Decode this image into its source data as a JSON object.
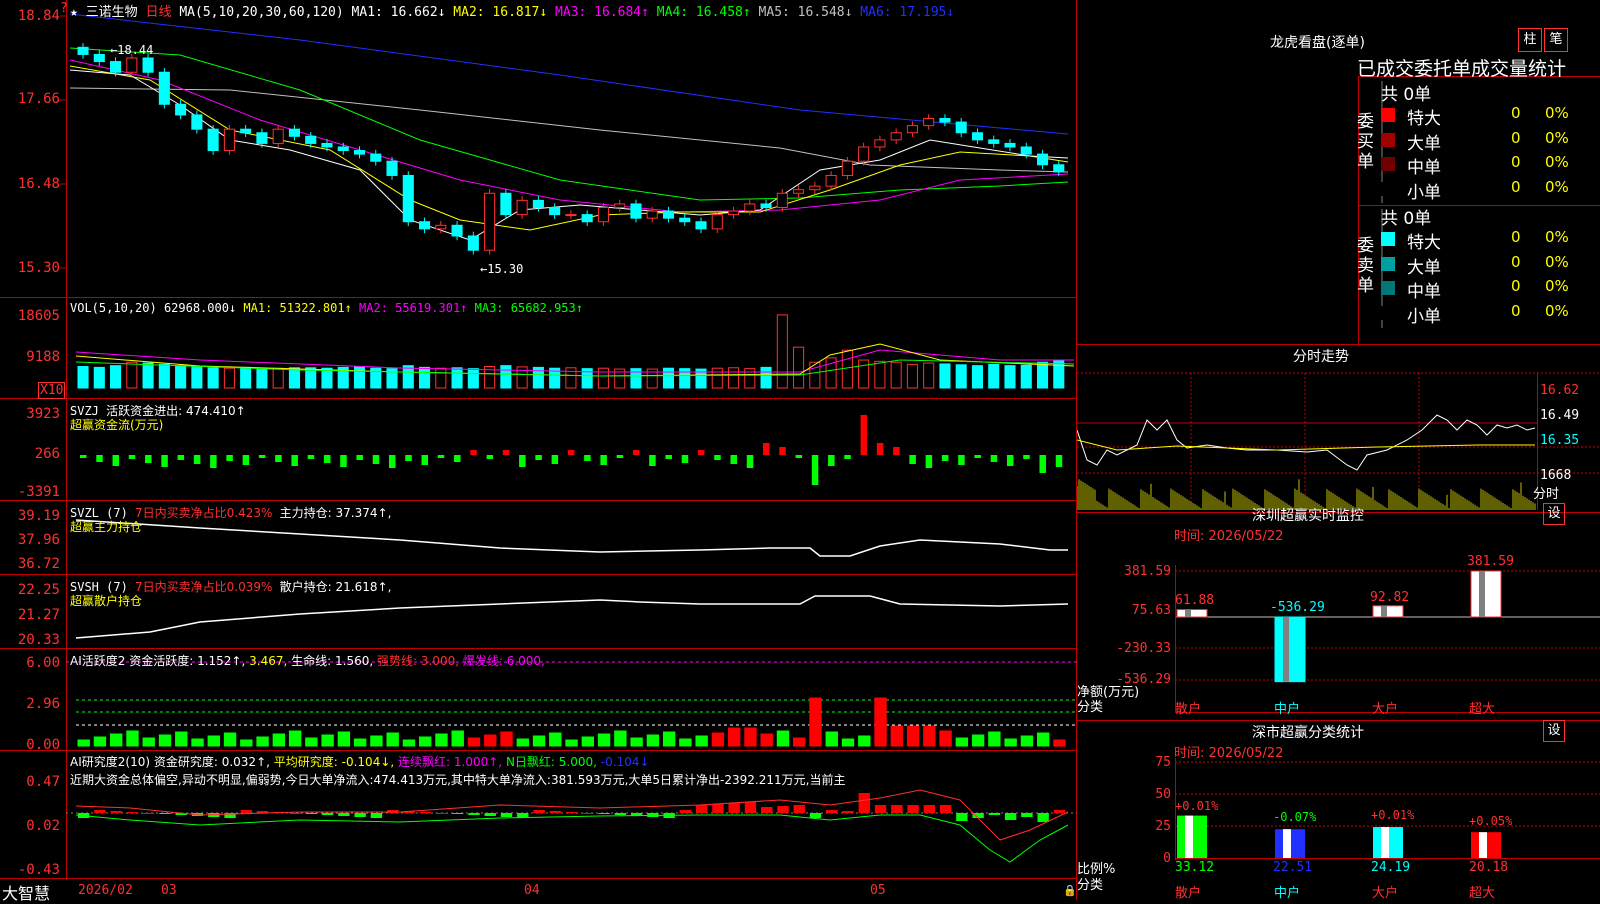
{
  "app": {
    "title": "大智慧"
  },
  "main": {
    "star": "★",
    "stock": "三诺生物",
    "period": "日线",
    "ma_label": "MA(5,10,20,30,60,120)",
    "ma": [
      {
        "text": "MA1: 16.662↓",
        "color": "#ffffff"
      },
      {
        "text": "MA2: 16.817↓",
        "color": "#ffff00"
      },
      {
        "text": "MA3: 16.684↑",
        "color": "#ff00ff"
      },
      {
        "text": "MA4: 16.458↑",
        "color": "#00ff00"
      },
      {
        "text": "MA5: 16.548↓",
        "color": "#c0c0c0"
      },
      {
        "text": "MA6: 17.195↓",
        "color": "#2030ff"
      }
    ],
    "price_axis": [
      "18.84",
      "17.66",
      "16.48",
      "15.30"
    ],
    "high_marker": "←18.44",
    "low_marker": "←15.30"
  },
  "vol": {
    "label": "VOL(5,10,20)",
    "value": "62968.000↓",
    "ma": [
      {
        "text": "MA1: 51322.801↑",
        "color": "#ffff00"
      },
      {
        "text": "MA2: 55619.301↑",
        "color": "#ff00ff"
      },
      {
        "text": "MA3: 65682.953↑",
        "color": "#00ff00"
      }
    ],
    "axis": [
      "18605",
      "9188"
    ],
    "unit": "X10"
  },
  "svzj": {
    "label": "SVZJ",
    "line1": "活跃资金进出: 474.410↑",
    "line2": "超赢资金流(万元)",
    "axis": [
      "3923",
      "266",
      "-3391"
    ]
  },
  "svzl": {
    "label": "SVZL (7)",
    "pct": "7日内买卖净占比0.423%",
    "hold": "主力持仓: 37.374↑,",
    "line2": "超赢主力持仓",
    "axis": [
      "39.19",
      "37.96",
      "36.72"
    ]
  },
  "svsh": {
    "label": "SVSH (7)",
    "pct": "7日内买卖净占比0.039%",
    "hold": "散户持仓: 21.618↑,",
    "line2": "超赢散户持仓",
    "axis": [
      "22.25",
      "21.27",
      "20.33"
    ]
  },
  "ai2": {
    "label": "AI活跃度2",
    "a": "资金活跃度: 1.152↑,",
    "b": "3.467,",
    "c": "生命线: 1.560,",
    "d": "强势线: 3.000,",
    "e": "爆发线: 6.000,",
    "axis": [
      "6.00",
      "2.96",
      "0.00"
    ]
  },
  "ai_research": {
    "label": "AI研究度2(10)",
    "a": "资金研究度: 0.032↑,",
    "b": "平均研究度: -0.104↓,",
    "c": "连续飘红: 1.000↑,",
    "d": "N日飘红: 5.000,",
    "e": "-0.104↓",
    "summary": "近期大资金总体偏空,异动不明显,偏弱势,今日大单净流入:474.413万元,其中特大单净流入:381.593万元,大单5日累计净出-2392.211万元,当前主",
    "axis": [
      "0.47",
      "0.02",
      "-0.43"
    ]
  },
  "date_axis": [
    "2026/02",
    "03",
    "04",
    "05"
  ],
  "lhb": {
    "title": "龙虎看盘(逐单)",
    "btn_bar": "柱",
    "btn_pen": "笔",
    "header": "已成交委托单成交量统计",
    "buy_label": "委买单",
    "sell_label": "委卖单",
    "buy_total": "共 0单",
    "sell_total": "共 0单",
    "buy_rows": [
      {
        "name": "特大",
        "color": "#ff0000",
        "qty": "0",
        "pct": "0%"
      },
      {
        "name": "大单",
        "color": "#a00000",
        "qty": "0",
        "pct": "0%"
      },
      {
        "name": "中单",
        "color": "#700000",
        "qty": "0",
        "pct": "0%"
      },
      {
        "name": "小单",
        "color": "#000000",
        "qty": "0",
        "pct": "0%"
      }
    ],
    "sell_rows": [
      {
        "name": "特大",
        "color": "#00ffff",
        "qty": "0",
        "pct": "0%"
      },
      {
        "name": "大单",
        "color": "#00a0a0",
        "qty": "0",
        "pct": "0%"
      },
      {
        "name": "中单",
        "color": "#007878",
        "qty": "0",
        "pct": "0%"
      },
      {
        "name": "小单",
        "color": "#000000",
        "qty": "0",
        "pct": "0%"
      }
    ]
  },
  "fenshi": {
    "title": "分时走势",
    "axis": [
      "16.62",
      "16.49",
      "16.35"
    ],
    "vol_axis": "1668",
    "label": "分时"
  },
  "monitor": {
    "title": "深圳超赢实时监控",
    "set_btn": "设",
    "time": "时间: 2026/05/22",
    "axis": [
      "381.59",
      "75.63",
      "-230.33",
      "-536.29"
    ],
    "y_label": "净额(万元)",
    "x_label": "分类",
    "values": [
      "61.88",
      "-536.29",
      "92.82",
      "381.59"
    ],
    "categories": [
      "散户",
      "中户",
      "大户",
      "超大"
    ]
  },
  "classify": {
    "title": "深市超赢分类统计",
    "set_btn": "设",
    "time": "时间: 2026/05/22",
    "axis": [
      "75",
      "50",
      "25",
      "0"
    ],
    "y_label": "比例%",
    "x_label": "分类",
    "changes": [
      "+0.01%",
      "-0.07%",
      "+0.01%",
      "+0.05%"
    ],
    "values": [
      "33.12",
      "22.51",
      "24.19",
      "20.18"
    ],
    "categories": [
      "散户",
      "中户",
      "大户",
      "超大"
    ]
  },
  "chart_data": [
    {
      "type": "candlestick",
      "title": "三诺生物 日线",
      "ylim": [
        15.3,
        18.84
      ],
      "ticks": [
        "18.84",
        "17.66",
        "16.48",
        "15.30"
      ],
      "x_labels": [
        "2026/02",
        "03",
        "04",
        "05"
      ],
      "close": [
        18.3,
        18.2,
        18.05,
        18.25,
        18.05,
        17.6,
        17.45,
        17.25,
        16.95,
        17.25,
        17.2,
        17.05,
        17.25,
        17.15,
        17.05,
        17.0,
        16.95,
        16.9,
        16.8,
        16.6,
        15.95,
        15.85,
        15.9,
        15.75,
        15.55,
        16.35,
        16.05,
        16.25,
        16.15,
        16.05,
        16.05,
        15.95,
        16.15,
        16.2,
        16.0,
        16.1,
        16.0,
        15.95,
        15.85,
        16.05,
        16.1,
        16.2,
        16.15,
        16.35,
        16.4,
        16.45,
        16.6,
        16.8,
        17.0,
        17.1,
        17.2,
        17.3,
        17.4,
        17.35,
        17.2,
        17.1,
        17.05,
        17.0,
        16.9,
        16.75,
        16.65
      ]
    },
    {
      "type": "bar",
      "title": "VOL(5,10,20)",
      "values": [
        50000,
        48000,
        52000,
        60000,
        58000,
        55000,
        52000,
        50000,
        47000,
        46000,
        48000,
        45000,
        46000,
        47000,
        47000,
        46000,
        48000,
        50000,
        46000,
        45000,
        52000,
        48000,
        46000,
        47000,
        45000,
        50000,
        52000,
        49000,
        48000,
        46000,
        47000,
        45000,
        46000,
        44000,
        45000,
        44000,
        46000,
        45000,
        44000,
        46000,
        47000,
        45000,
        48000,
        170000,
        95000,
        60000,
        70000,
        88000,
        65000,
        62000,
        60000,
        55000,
        58000,
        56000,
        54000,
        52000,
        55000,
        52000,
        53000,
        60000,
        62968
      ]
    }
  ]
}
